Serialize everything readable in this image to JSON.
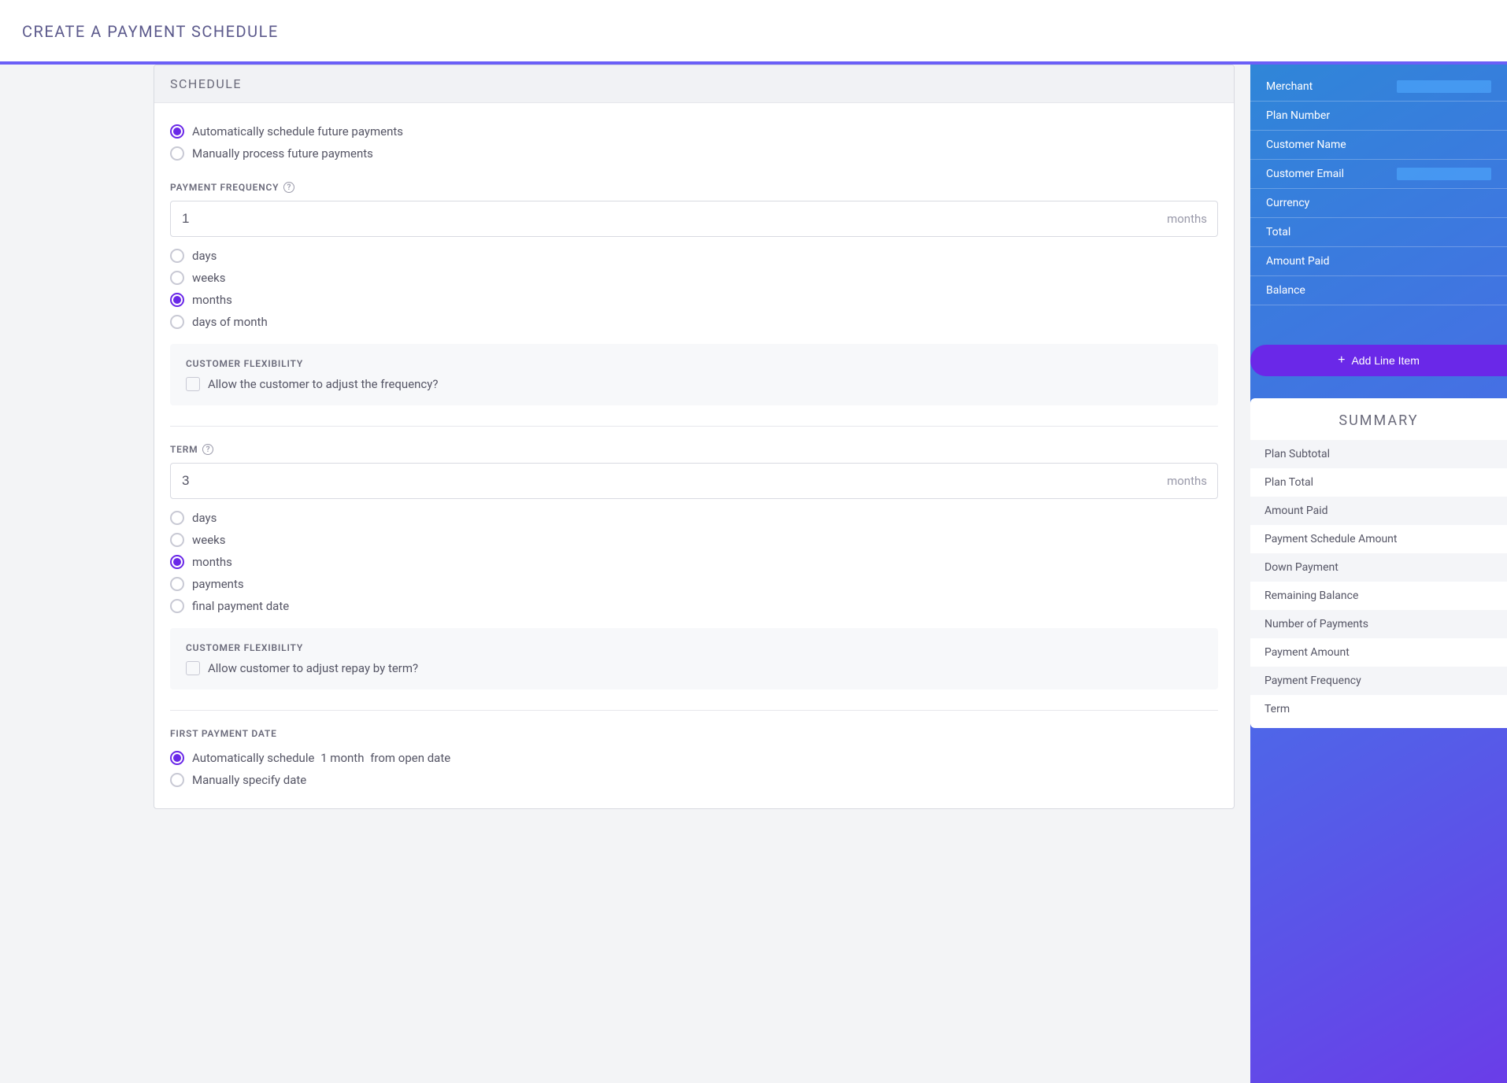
{
  "page": {
    "title": "CREATE A PAYMENT SCHEDULE"
  },
  "schedule": {
    "panel_title": "SCHEDULE",
    "mode": {
      "auto": "Automatically schedule future payments",
      "manual": "Manually process future payments"
    },
    "frequency": {
      "label": "PAYMENT FREQUENCY",
      "value": "1",
      "suffix": "months",
      "units": {
        "days": "days",
        "weeks": "weeks",
        "months": "months",
        "days_of_month": "days of month"
      },
      "flex_title": "CUSTOMER FLEXIBILITY",
      "flex_label": "Allow the customer to adjust the frequency?"
    },
    "term": {
      "label": "TERM",
      "value": "3",
      "suffix": "months",
      "units": {
        "days": "days",
        "weeks": "weeks",
        "months": "months",
        "payments": "payments",
        "final_payment_date": "final payment date"
      },
      "flex_title": "CUSTOMER FLEXIBILITY",
      "flex_label": "Allow customer to adjust repay by term?"
    },
    "first_payment": {
      "label": "FIRST PAYMENT DATE",
      "auto_prefix": "Automatically schedule",
      "auto_interval": "1 month",
      "auto_suffix": "from open date",
      "manual": "Manually specify date"
    }
  },
  "sidebar": {
    "info": {
      "merchant": "Merchant",
      "plan_number": "Plan Number",
      "customer_name": "Customer Name",
      "customer_email": "Customer Email",
      "currency": "Currency",
      "total": "Total",
      "amount_paid": "Amount Paid",
      "balance": "Balance"
    },
    "add_button": "Add Line Item",
    "summary": {
      "title": "SUMMARY",
      "rows": {
        "plan_subtotal": "Plan Subtotal",
        "plan_total": "Plan Total",
        "amount_paid": "Amount Paid",
        "payment_schedule_amount": "Payment Schedule Amount",
        "down_payment": "Down Payment",
        "remaining_balance": "Remaining Balance",
        "number_of_payments": "Number of Payments",
        "payment_amount": "Payment Amount",
        "payment_frequency": "Payment Frequency",
        "term": "Term"
      }
    }
  }
}
